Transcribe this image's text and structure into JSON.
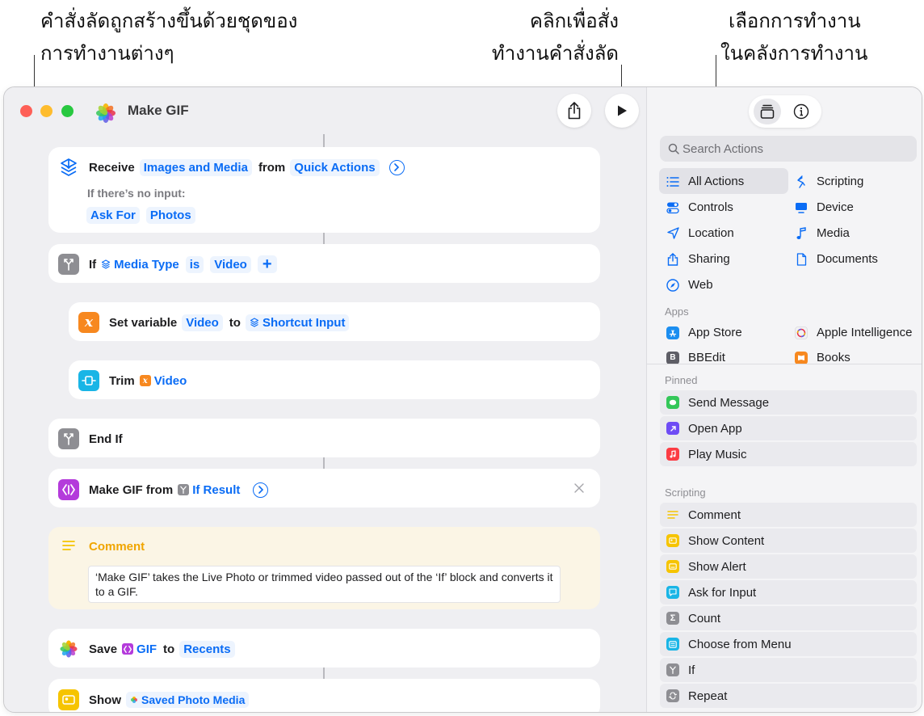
{
  "callouts": {
    "left_line1": "คำสั่งลัดถูกสร้างขึ้นด้วยชุดของ",
    "left_line2": "การทำงานต่างๆ",
    "mid_line1": "คลิกเพื่อสั่ง",
    "mid_line2": "ทำงานคำสั่งลัด",
    "right_line1": "เลือกการทำงาน",
    "right_line2": "ในคลังการทำงาน"
  },
  "window": {
    "title": "Make GIF"
  },
  "actions": {
    "receive": {
      "kw": "Receive",
      "token1": "Images and Media",
      "from": "from",
      "token2": "Quick Actions",
      "no_input_label": "If there’s no input:",
      "token3": "Ask For",
      "token4": "Photos"
    },
    "if": {
      "kw": "If",
      "token1": "Media Type",
      "token2": "is",
      "token3": "Video",
      "plus": "+"
    },
    "set_variable": {
      "kw": "Set variable",
      "token1": "Video",
      "to": "to",
      "token2": "Shortcut Input"
    },
    "trim": {
      "kw": "Trim",
      "token1": "Video"
    },
    "end_if": {
      "kw": "End If"
    },
    "make_gif": {
      "kw": "Make GIF from",
      "token1": "If Result"
    },
    "comment": {
      "title": "Comment",
      "text": "‘Make GIF’ takes the Live Photo or trimmed video passed out of the ‘If’ block and converts it to a GIF."
    },
    "save": {
      "kw": "Save",
      "token1": "GIF",
      "to": "to",
      "token2": "Recents"
    },
    "show": {
      "kw": "Show",
      "token1": "Saved Photo Media"
    }
  },
  "sidebar": {
    "search_placeholder": "Search Actions",
    "categories_left": [
      "All Actions",
      "Controls",
      "Location",
      "Sharing",
      "Web"
    ],
    "categories_right": [
      "Scripting",
      "Device",
      "Media",
      "Documents"
    ],
    "apps_header": "Apps",
    "apps": [
      "App Store",
      "Apple Intelligence",
      "BBEdit",
      "Books"
    ],
    "pinned_header": "Pinned",
    "pinned": [
      "Send Message",
      "Open App",
      "Play Music"
    ],
    "scripting_header": "Scripting",
    "scripting": [
      "Comment",
      "Show Content",
      "Show Alert",
      "Ask for Input",
      "Count",
      "Choose from Menu",
      "If",
      "Repeat"
    ]
  },
  "colors": {
    "accent": "#0a6cf5",
    "close": "#fe5f57",
    "minimize": "#febc2e",
    "zoom": "#28c840",
    "gray_icon": "#8e8e93",
    "orange_icon": "#f7881f",
    "cyan_icon": "#19b5e6",
    "purple_icon": "#b43bdb",
    "yellow_icon": "#f6c400",
    "comment_bg": "#fbf5e5"
  },
  "icons": {
    "share": "share-icon",
    "run": "play-icon",
    "library": "library-icon",
    "info": "info-icon",
    "search": "magnifier-icon"
  }
}
